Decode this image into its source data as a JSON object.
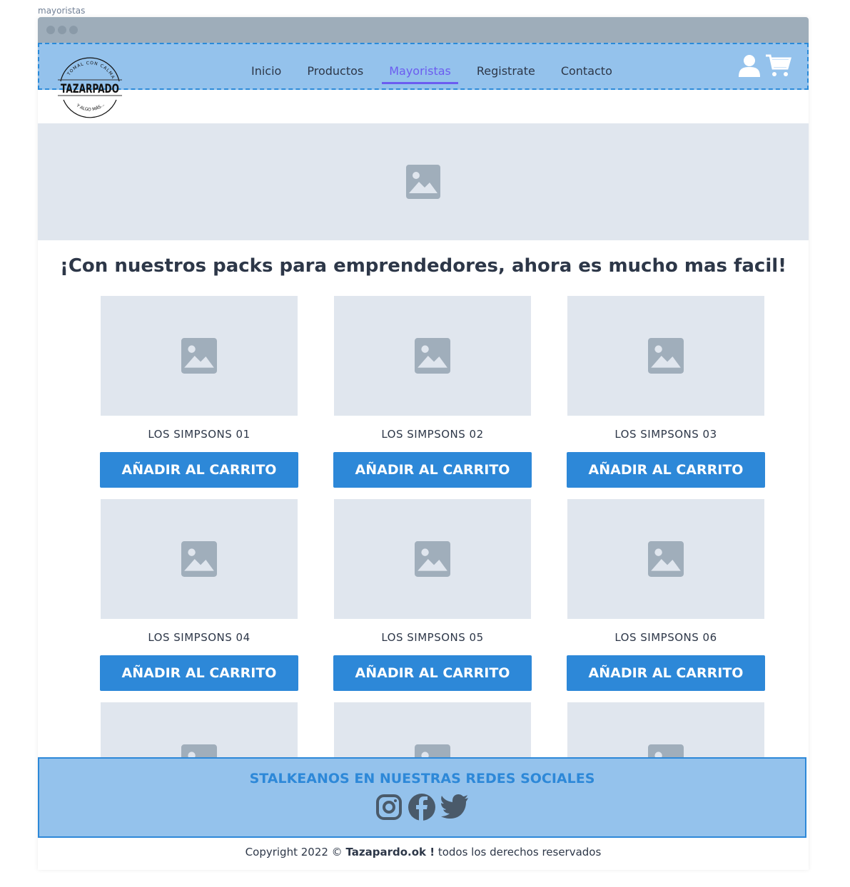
{
  "page_name": "mayoristas",
  "logo": {
    "top": "TOMAL CON CALMA",
    "name": "TAZARPADO",
    "bottom": "Y ALGO MÁS..."
  },
  "nav": {
    "items": [
      "Inicio",
      "Productos",
      "Mayoristas",
      "Registrate",
      "Contacto"
    ],
    "active": "Mayoristas"
  },
  "heading": "¡Con nuestros packs para emprendedores, ahora es mucho mas facil!",
  "products": [
    {
      "name": "LOS SIMPSONS 01",
      "button": "AÑADIR AL CARRITO"
    },
    {
      "name": "LOS SIMPSONS 02",
      "button": "AÑADIR AL CARRITO"
    },
    {
      "name": "LOS SIMPSONS 03",
      "button": "AÑADIR AL CARRITO"
    },
    {
      "name": "LOS SIMPSONS 04",
      "button": "AÑADIR AL CARRITO"
    },
    {
      "name": "LOS SIMPSONS 05",
      "button": "AÑADIR AL CARRITO"
    },
    {
      "name": "LOS SIMPSONS 06",
      "button": "AÑADIR AL CARRITO"
    }
  ],
  "footer": {
    "title": "STALKEANOS EN NUESTRAS REDES SOCIALES",
    "copy_pre": "Copyright 2022 © ",
    "copy_brand": "Tazapardo.ok !",
    "copy_post": " todos los derechos reservados"
  },
  "colors": {
    "nav_bg": "#94c2ec",
    "accent": "#2d88d8",
    "active": "#6b5cf0"
  }
}
